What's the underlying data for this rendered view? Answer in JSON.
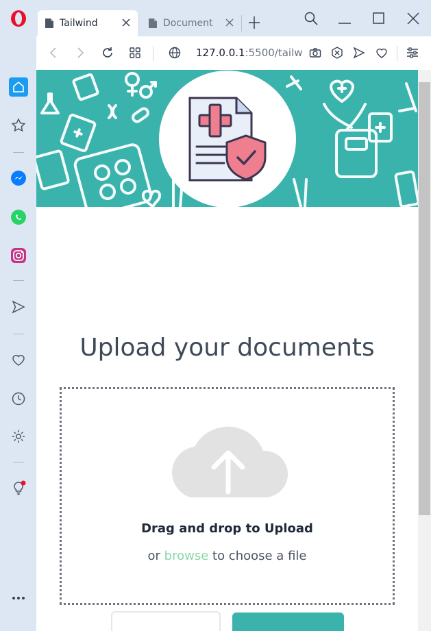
{
  "browser": {
    "tabs": [
      {
        "label": "Tailwind",
        "active": true
      },
      {
        "label": "Document",
        "active": false
      }
    ],
    "url": {
      "host": "127.0.0.1",
      "rest": ":5500/tailw"
    }
  },
  "sidebar": {
    "icons": [
      "home-icon",
      "star-icon",
      "messenger-icon",
      "whatsapp-icon",
      "instagram-icon",
      "send-icon",
      "heart-icon",
      "history-icon",
      "settings-icon",
      "lightbulb-icon",
      "more-icon"
    ]
  },
  "page": {
    "title": "Upload your documents",
    "dropzone": {
      "heading": "Drag and drop to Upload",
      "or": "or",
      "browse": "browse",
      "suffix": "to choose a file"
    }
  },
  "colors": {
    "banner": "#3bb3ad",
    "accent_green": "#86d8a7",
    "opera_red": "#e8102a"
  }
}
